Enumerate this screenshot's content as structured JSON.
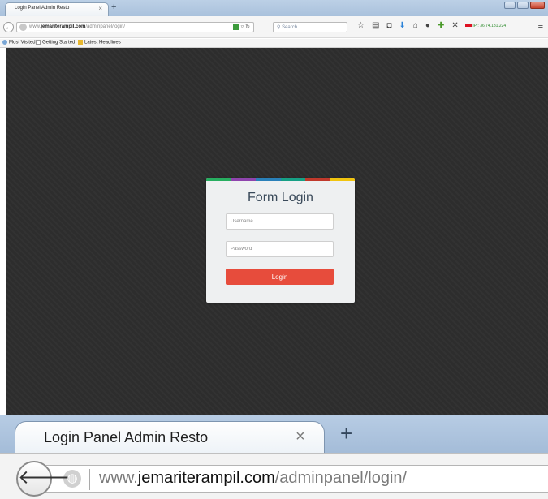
{
  "browser": {
    "tab_title": "Login Panel Admin Resto",
    "tab_close": "×",
    "new_tab": "+",
    "url_prefix": "www.",
    "url_domain": "jemariterampil.com",
    "url_path": "/adminpanel/login/",
    "search_placeholder": "Search",
    "ip_text": "IP : 36.74.181.224",
    "bookmarks": [
      "Most Visited",
      "Getting Started",
      "Latest Headlines"
    ]
  },
  "icons": {
    "back": "back-arrow-icon",
    "globe": "globe-icon",
    "reload": "reload-icon",
    "search": "search-icon",
    "star": "bookmark-star-icon",
    "library": "library-icon",
    "pocket": "pocket-icon",
    "download": "download-icon",
    "home": "home-icon",
    "chat": "chat-icon",
    "puzzle": "addon-icon",
    "x": "x-extension-icon",
    "menu": "hamburger-menu-icon"
  },
  "login": {
    "title": "Form Login",
    "username_placeholder": "Username",
    "password_placeholder": "Password",
    "button_label": "Login",
    "stripe_colors": [
      "#27ae60",
      "#8e44ad",
      "#2980b9",
      "#16a085",
      "#c0392b",
      "#f1c40f"
    ]
  },
  "colors": {
    "page_bg": "#2d2d2d",
    "card_bg": "#eef0f1",
    "login_button": "#e74c3c"
  }
}
